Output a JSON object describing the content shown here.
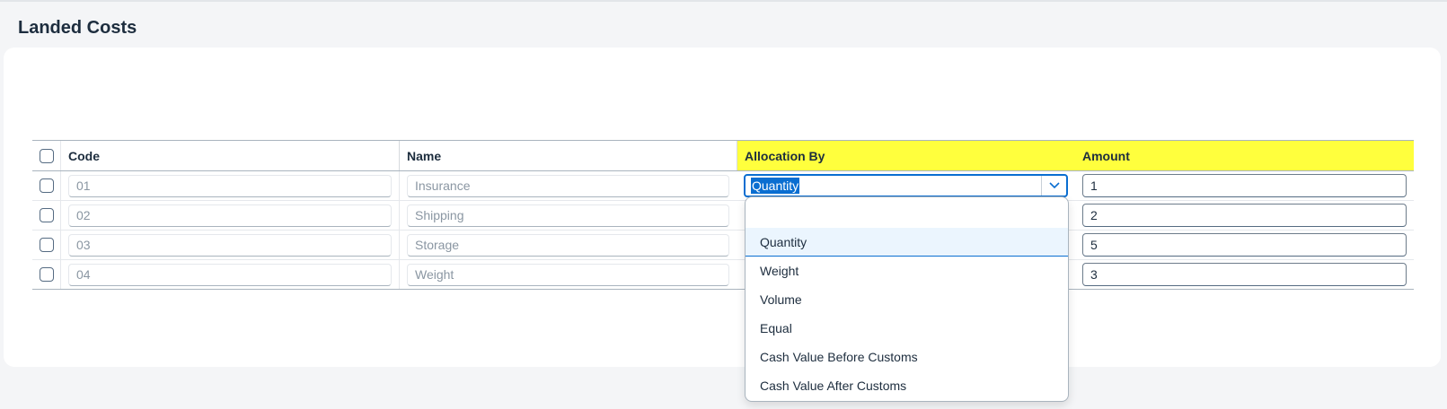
{
  "page": {
    "title": "Landed Costs"
  },
  "table": {
    "columns": [
      "Code",
      "Name",
      "Allocation By",
      "Amount"
    ],
    "rows": [
      {
        "code": "01",
        "name": "Insurance",
        "allocation": "Quantity",
        "amount": "1"
      },
      {
        "code": "02",
        "name": "Shipping",
        "amount": "2"
      },
      {
        "code": "03",
        "name": "Storage",
        "amount": "5"
      },
      {
        "code": "04",
        "name": "Weight",
        "amount": "3"
      }
    ]
  },
  "dropdown": {
    "options": [
      "",
      "Quantity",
      "Weight",
      "Volume",
      "Equal",
      "Cash Value Before Customs",
      "Cash Value After Customs"
    ],
    "selected": "Quantity"
  },
  "colors": {
    "highlight": "#ffff3d",
    "focus": "#0a6ed1"
  },
  "icons": {
    "combo_toggle": "chevron-down-icon"
  }
}
